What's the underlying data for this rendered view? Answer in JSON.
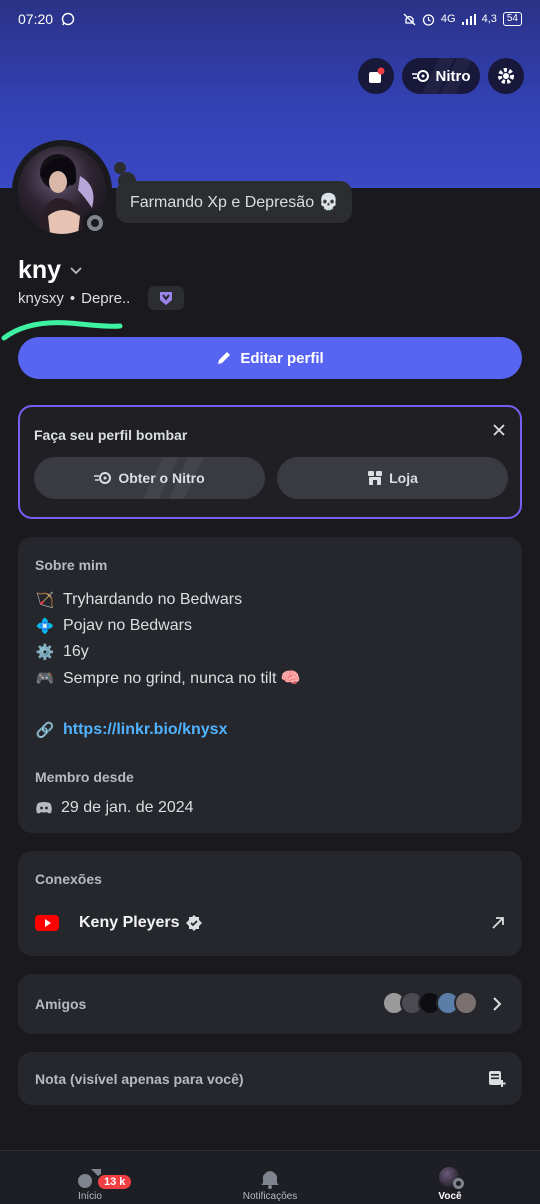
{
  "status_bar": {
    "time": "07:20",
    "signal_text": "4G",
    "speed_text": "4,3",
    "battery": "54"
  },
  "top_actions": {
    "nitro_label": "Nitro"
  },
  "profile": {
    "display_name": "kny",
    "username": "knysxy",
    "separator": "•",
    "pronoun_short": "Depre..",
    "custom_status": "Farmando Xp e Depresão 💀",
    "presence": "offline"
  },
  "edit_button": {
    "label": "Editar perfil"
  },
  "promo": {
    "title": "Faça seu perfil bombar",
    "nitro_button": "Obter o Nitro",
    "shop_button": "Loja"
  },
  "about": {
    "label": "Sobre mim",
    "lines": [
      {
        "emoji": "🏹",
        "text": "Tryhardando no Bedwars"
      },
      {
        "emoji": "💠",
        "text": "Pojav no Bedwars"
      },
      {
        "emoji": "⚙️",
        "text": "16y"
      },
      {
        "emoji": "🎮",
        "text": "Sempre no grind, nunca no tilt 🧠"
      }
    ],
    "link_emoji": "🔗",
    "link": "https://linkr.bio/knysx",
    "member_since_label": "Membro desde",
    "member_since": "29 de jan. de 2024"
  },
  "connections": {
    "label": "Conexões",
    "items": [
      {
        "service": "youtube-icon",
        "name": "Keny Pleyers",
        "verified": true
      }
    ]
  },
  "friends": {
    "label": "Amigos"
  },
  "note": {
    "placeholder": "Nota (visível apenas para você)"
  },
  "bottom_nav": {
    "home_label": "Início",
    "home_badge": "13 k",
    "notifications_label": "Notificações",
    "you_label": "Você"
  },
  "colors": {
    "accent": "#5865f2",
    "banner": "#3341b3",
    "link": "#4fb3ff",
    "promo_border": "#7b5cf5",
    "badge_red": "#f23f43",
    "youtube_red": "#ff0000"
  }
}
